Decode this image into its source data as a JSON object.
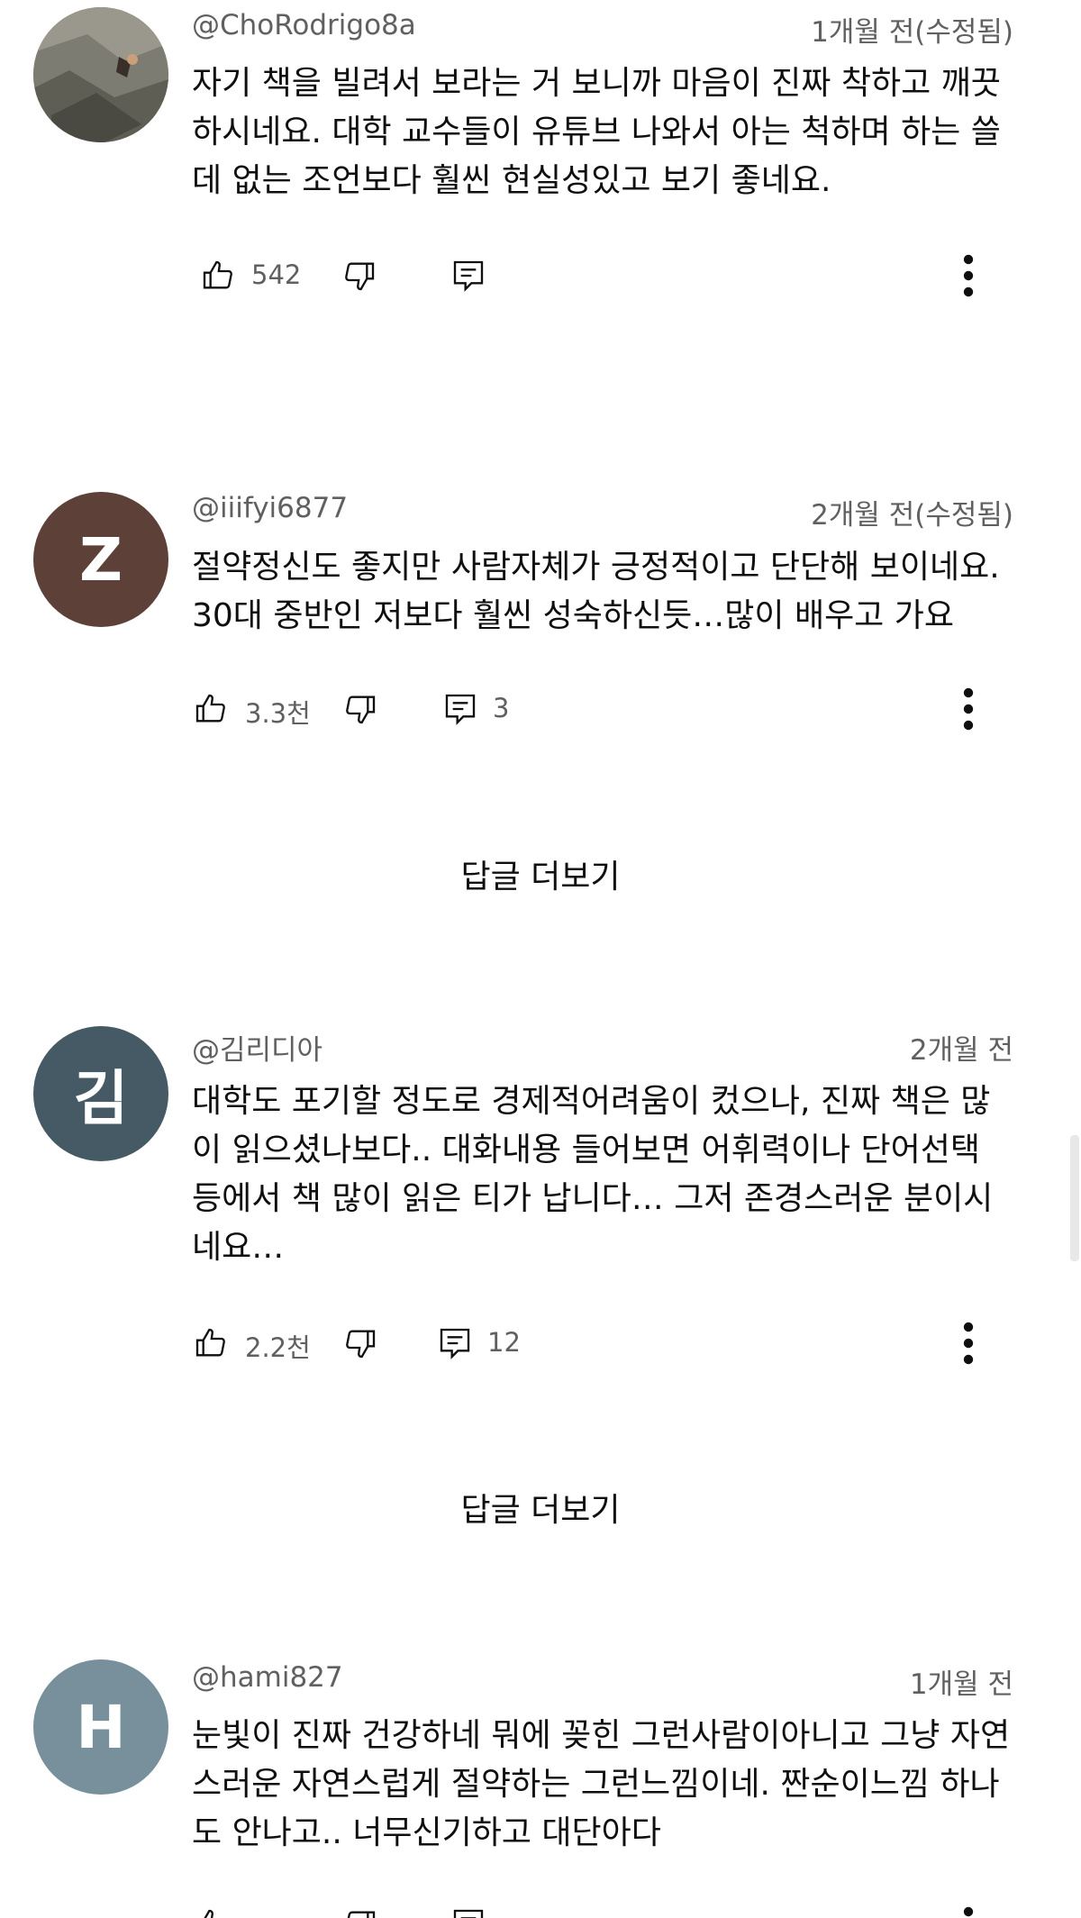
{
  "comments": [
    {
      "handle": "@ChoRodrigo8a",
      "time": "1개월 전(수정됨)",
      "lines": [
        "자기 책을 빌려서 보라는 거 보니까 마음이 진짜 착하고 깨끗",
        "하시네요. 대학 교수들이 유튜브 나와서 아는 척하며 하는 쓸",
        "데 없는 조언보다 훨씬 현실성있고 보기 좋네요."
      ],
      "likes": "542",
      "replies": "",
      "avatar_letter": "",
      "avatar_color": "#8a8a80"
    },
    {
      "handle": "@iiifyi6877",
      "time": "2개월 전(수정됨)",
      "lines": [
        "절약정신도 좋지만 사람자체가 긍정적이고 단단해 보이네요.",
        "30대 중반인 저보다 훨씬 성숙하신듯…많이 배우고 가요"
      ],
      "likes": "3.3천",
      "replies": "3",
      "avatar_letter": "Z",
      "avatar_color": "#5d4037",
      "replies_link": "답글 더보기"
    },
    {
      "handle": "@김리디아",
      "time": "2개월 전",
      "lines": [
        "대학도 포기할 정도로 경제적어려움이 컸으나, 진짜 책은 많",
        "이 읽으셨나보다.. 대화내용 들어보면 어휘력이나 단어선택",
        "등에서 책 많이 읽은 티가 납니다… 그저 존경스러운 분이시",
        "네요…"
      ],
      "likes": "2.2천",
      "replies": "12",
      "avatar_letter": "김",
      "avatar_color": "#455a64",
      "replies_link": "답글 더보기"
    },
    {
      "handle": "@hami827",
      "time": "1개월 전",
      "lines": [
        "눈빛이 진짜 건강하네 뭐에 꽂힌 그런사람이아니고 그냥 자연",
        "스러운 자연스럽게 절약하는 그런느낌이네. 짠순이느낌 하나",
        "도 안나고.. 너무신기하고 대단아다"
      ],
      "avatar_letter": "H",
      "avatar_color": "#78909c"
    }
  ],
  "icons": {
    "like": "thumbs-up-icon",
    "dislike": "thumbs-down-icon",
    "reply": "comment-reply-icon",
    "more": "more-vertical-icon"
  }
}
